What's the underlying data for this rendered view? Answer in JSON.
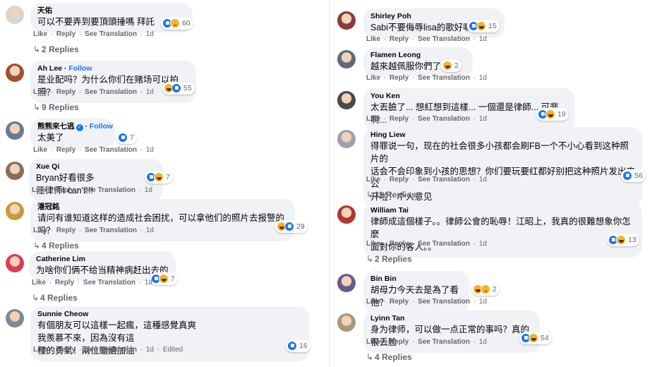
{
  "left": [
    {
      "name": "天佑",
      "follow": "",
      "verified": false,
      "lines": [
        "可以不要弄到要頂頭捶嗎 拜託"
      ],
      "emoji_after": [
        "sad"
      ],
      "reactions": [
        "like",
        "sad"
      ],
      "count": "60",
      "actions": {
        "like": "Like",
        "reply": "Reply",
        "translate": "See Translation",
        "time": "1d",
        "edited": ""
      },
      "replies": "2 Replies",
      "avatar": "#d9d4cf"
    },
    {
      "name": "Ah Lee",
      "follow": "Follow",
      "verified": false,
      "lines": [
        "是业配吗？为什么你们在赌场可以拍照？"
      ],
      "emoji_after": [],
      "reactions": [
        "haha",
        "like"
      ],
      "count": "55",
      "actions": {
        "like": "Like",
        "reply": "Reply",
        "translate": "See Translation",
        "time": "1d",
        "edited": ""
      },
      "replies": "9 Replies",
      "avatar": "#a0522d"
    },
    {
      "name": "熊熊來七逃",
      "follow": "Follow",
      "verified": true,
      "lines": [
        "太美了"
      ],
      "emoji_after": [],
      "reactions": [
        "like"
      ],
      "count": "7",
      "actions": {
        "like": "Like",
        "reply": "Reply",
        "translate": "See Translation",
        "time": "1d",
        "edited": ""
      },
      "replies": "",
      "avatar": "#6b7a8f"
    },
    {
      "name": "Xue Qi",
      "follow": "",
      "verified": false,
      "lines": [
        "Bryan好看很多",
        "江律师I can't!!!"
      ],
      "emoji_after": [],
      "reactions": [
        "like",
        "haha"
      ],
      "count": "7",
      "actions": {
        "like": "Like",
        "reply": "Reply",
        "translate": "See Translation",
        "time": "1d",
        "edited": ""
      },
      "replies": "",
      "avatar": "#8b6d5c"
    },
    {
      "name": "潘冠銘",
      "follow": "",
      "verified": false,
      "lines": [
        "请问有谁知道这样的造成社会困扰，可以拿他们的照片去报警的吗？"
      ],
      "emoji_after": [],
      "reactions": [
        "haha",
        "like"
      ],
      "count": "29",
      "actions": {
        "like": "Like",
        "reply": "Reply",
        "translate": "See Translation",
        "time": "1d",
        "edited": ""
      },
      "replies": "4 Replies",
      "avatar": "#c79a3a"
    },
    {
      "name": "Catherine Lim",
      "follow": "",
      "verified": false,
      "lines": [
        "为啥你们俩不给当精神病赶出去的"
      ],
      "emoji_after": [
        "sad"
      ],
      "reactions": [
        "like",
        "haha"
      ],
      "count": "7",
      "actions": {
        "like": "Like",
        "reply": "Reply",
        "translate": "See Translation",
        "time": "1d",
        "edited": ""
      },
      "replies": "4 Replies",
      "avatar": "#e03a5a"
    },
    {
      "name": "Sunnie Cheow",
      "follow": "",
      "verified": false,
      "lines": [
        "有個朋友可以這樣一起瘋，這種感覺真爽",
        "我羨慕不來，因為沒有這",
        "樣的勇氣！兩位繼續加油"
      ],
      "emoji_after": [],
      "reactions": [
        "like"
      ],
      "count": "16",
      "actions": {
        "like": "Like",
        "reply": "Reply",
        "translate": "See Translation",
        "time": "1d",
        "edited": "Edited"
      },
      "replies": "",
      "avatar": "#7d8a99"
    }
  ],
  "right": [
    {
      "name": "Shirley Poh",
      "follow": "",
      "verified": false,
      "lines": [
        "Sabi不要侮辱lisa的歌好嘛"
      ],
      "emoji_after": [],
      "reactions": [
        "like",
        "haha"
      ],
      "count": "15",
      "actions": {
        "like": "Like",
        "reply": "Reply",
        "translate": "See Translation",
        "time": "1d",
        "edited": ""
      },
      "replies": "",
      "avatar": "#8a3b3b"
    },
    {
      "name": "Flamen Leong",
      "follow": "",
      "verified": false,
      "lines": [
        "越來越佩服你們了"
      ],
      "emoji_after": [],
      "reactions": [
        "haha"
      ],
      "count": "2",
      "actions": {
        "like": "Like",
        "reply": "Reply",
        "translate": "See Translation",
        "time": "1d",
        "edited": ""
      },
      "replies": "",
      "avatar": "#5c6b7a"
    },
    {
      "name": "You Ken",
      "follow": "",
      "verified": false,
      "lines": [
        "太丟臉了... 想紅想到這樣... 一個還是律師... 可悲啊..."
      ],
      "emoji_after": [],
      "reactions": [
        "like",
        "haha"
      ],
      "count": "19",
      "actions": {
        "like": "Like",
        "reply": "Reply",
        "translate": "See Translation",
        "time": "1d",
        "edited": ""
      },
      "replies": "",
      "avatar": "#4a4a4a"
    },
    {
      "name": "Hing Liew",
      "follow": "",
      "verified": false,
      "lines": [
        "得罪说一句，现在的社会很多小孩都会刷FB一个不小心看到这种照片的",
        "话会不会印象到小孩的思想？你们要玩要红都好别把这种照片发出来公",
        "开啦！个人意见"
      ],
      "emoji_after": [],
      "reactions": [
        "like"
      ],
      "count": "56",
      "actions": {
        "like": "Like",
        "reply": "Reply",
        "translate": "See Translation",
        "time": "1d",
        "edited": ""
      },
      "replies": "11 Replies",
      "avatar": "#9aa3ad"
    },
    {
      "name": "William Tai",
      "follow": "",
      "verified": false,
      "lines": [
        "律師成這個樣子。。律師公會的恥辱！江昭上，我真的很難想象你怎麼",
        "面對你的客人。。"
      ],
      "emoji_after": [],
      "reactions": [
        "like",
        "haha"
      ],
      "count": "13",
      "actions": {
        "like": "Like",
        "reply": "Reply",
        "translate": "See Translation",
        "time": "1d",
        "edited": ""
      },
      "replies": "2 Replies",
      "avatar": "#b5352f"
    },
    {
      "name": "Bin Bin",
      "follow": "",
      "verified": false,
      "lines": [
        "胡母力今天去是為了看他？"
      ],
      "emoji_after": [],
      "reactions": [
        "haha",
        "sad"
      ],
      "count": "2",
      "actions": {
        "like": "Like",
        "reply": "Reply",
        "translate": "See Translation",
        "time": "1d",
        "edited": ""
      },
      "replies": "",
      "avatar": "#6a5a8a"
    },
    {
      "name": "Lyinn Tan",
      "follow": "",
      "verified": false,
      "lines": [
        "身为律师，可以做一点正常的事吗？真的很丢脸"
      ],
      "emoji_after": [],
      "reactions": [
        "like",
        "haha"
      ],
      "count": "54",
      "actions": {
        "like": "Like",
        "reply": "Reply",
        "translate": "See Translation",
        "time": "1d",
        "edited": ""
      },
      "replies": "4 Replies",
      "avatar": "#a89878"
    }
  ]
}
